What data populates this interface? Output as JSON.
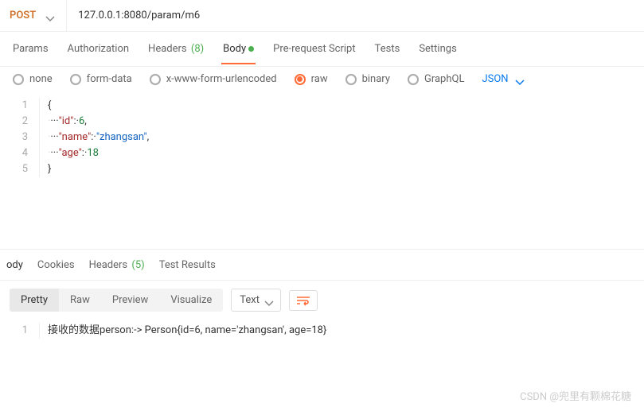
{
  "request": {
    "method": "POST",
    "url": "127.0.0.1:8080/param/m6"
  },
  "tabs": {
    "params": "Params",
    "auth": "Authorization",
    "headers": "Headers",
    "headers_count": "(8)",
    "body": "Body",
    "prerequest": "Pre-request Script",
    "tests": "Tests",
    "settings": "Settings"
  },
  "body_options": {
    "none": "none",
    "formdata": "form-data",
    "xwww": "x-www-form-urlencoded",
    "raw": "raw",
    "binary": "binary",
    "graphql": "GraphQL",
    "format": "JSON"
  },
  "editor": {
    "l1": "{",
    "l2_key": "\"id\"",
    "l2_val": "6",
    "l3_key": "\"name\"",
    "l3_val": "\"zhangsan\"",
    "l4_key": "\"age\"",
    "l4_val": "18",
    "l5": "}"
  },
  "response_tabs": {
    "body": "ody",
    "cookies": "Cookies",
    "headers": "Headers",
    "headers_count": "(5)",
    "tests": "Test Results"
  },
  "response_toolbar": {
    "pretty": "Pretty",
    "raw": "Raw",
    "preview": "Preview",
    "visualize": "Visualize",
    "text": "Text"
  },
  "response_body": {
    "line1": "接收的数据person:-> Person{id=6, name='zhangsan', age=18}"
  },
  "watermark": "CSDN @兜里有颗棉花糖"
}
